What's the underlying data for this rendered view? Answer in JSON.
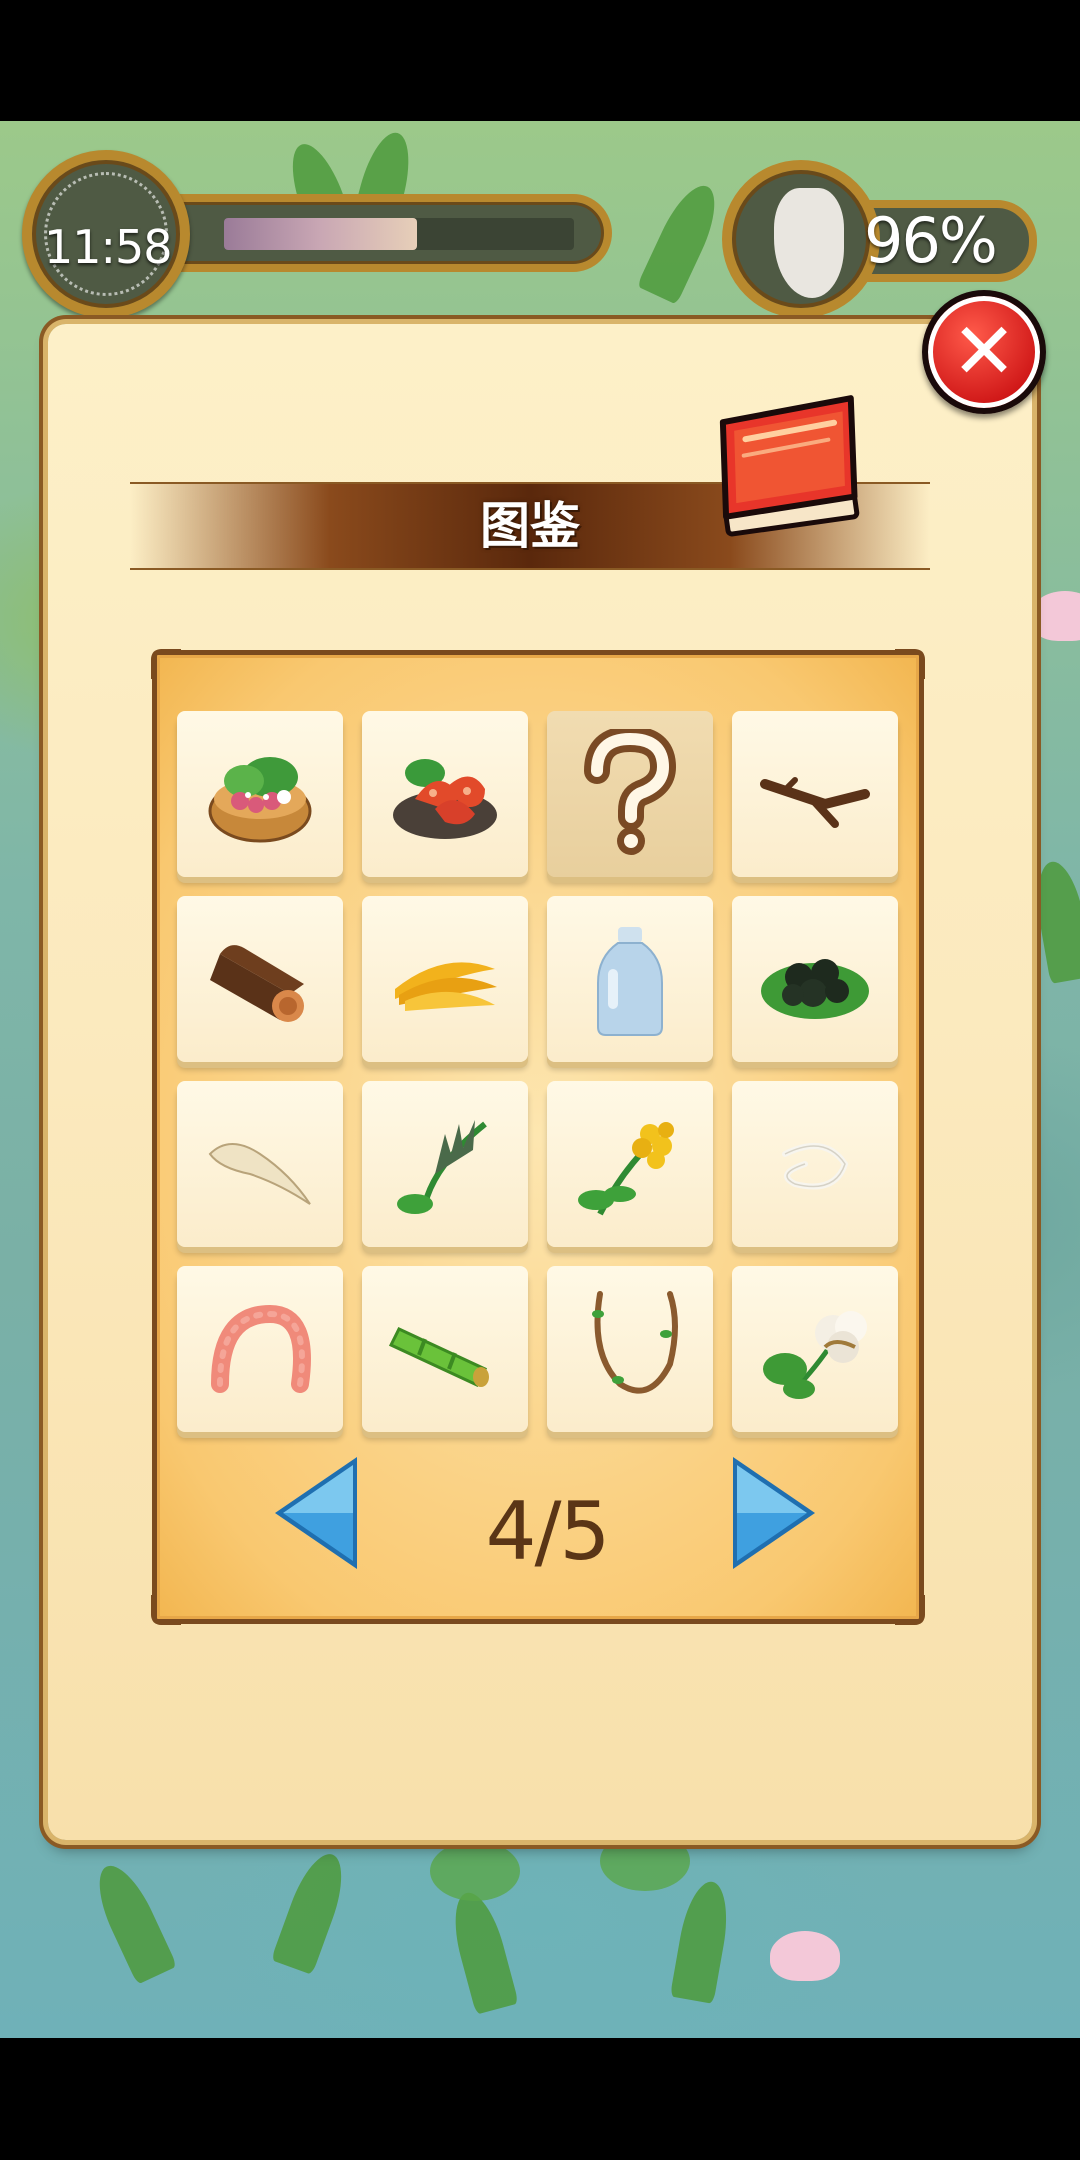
{
  "hud": {
    "time": "11:58",
    "time_progress": 0.55,
    "fullness": "96%"
  },
  "dialog": {
    "title": "图鉴",
    "page_indicator": "4/5"
  },
  "collection": {
    "items": [
      {
        "icon": "octopus-salad-bowl-icon",
        "known": true
      },
      {
        "icon": "shrimp-plate-icon",
        "known": true
      },
      {
        "icon": "question-mark-icon",
        "known": false,
        "label": "?"
      },
      {
        "icon": "branch-icon",
        "known": true
      },
      {
        "icon": "wood-log-icon",
        "known": true
      },
      {
        "icon": "banana-bunch-icon",
        "known": true
      },
      {
        "icon": "milk-bottle-icon",
        "known": true
      },
      {
        "icon": "black-berries-leaf-icon",
        "known": true
      },
      {
        "icon": "tusk-root-icon",
        "known": true
      },
      {
        "icon": "spiky-herb-icon",
        "known": true
      },
      {
        "icon": "yellow-flower-herb-icon",
        "known": true
      },
      {
        "icon": "white-string-icon",
        "known": true
      },
      {
        "icon": "worm-icon",
        "known": true
      },
      {
        "icon": "bamboo-piece-icon",
        "known": true
      },
      {
        "icon": "vine-rope-icon",
        "known": true
      },
      {
        "icon": "cotton-plant-icon",
        "known": true
      }
    ]
  },
  "colors": {
    "panel": "#fbe9bd",
    "grid_bg": "#f9c870",
    "title_band": "#5a280c",
    "close_red": "#d01818",
    "arrow_blue": "#3fa0e0"
  }
}
